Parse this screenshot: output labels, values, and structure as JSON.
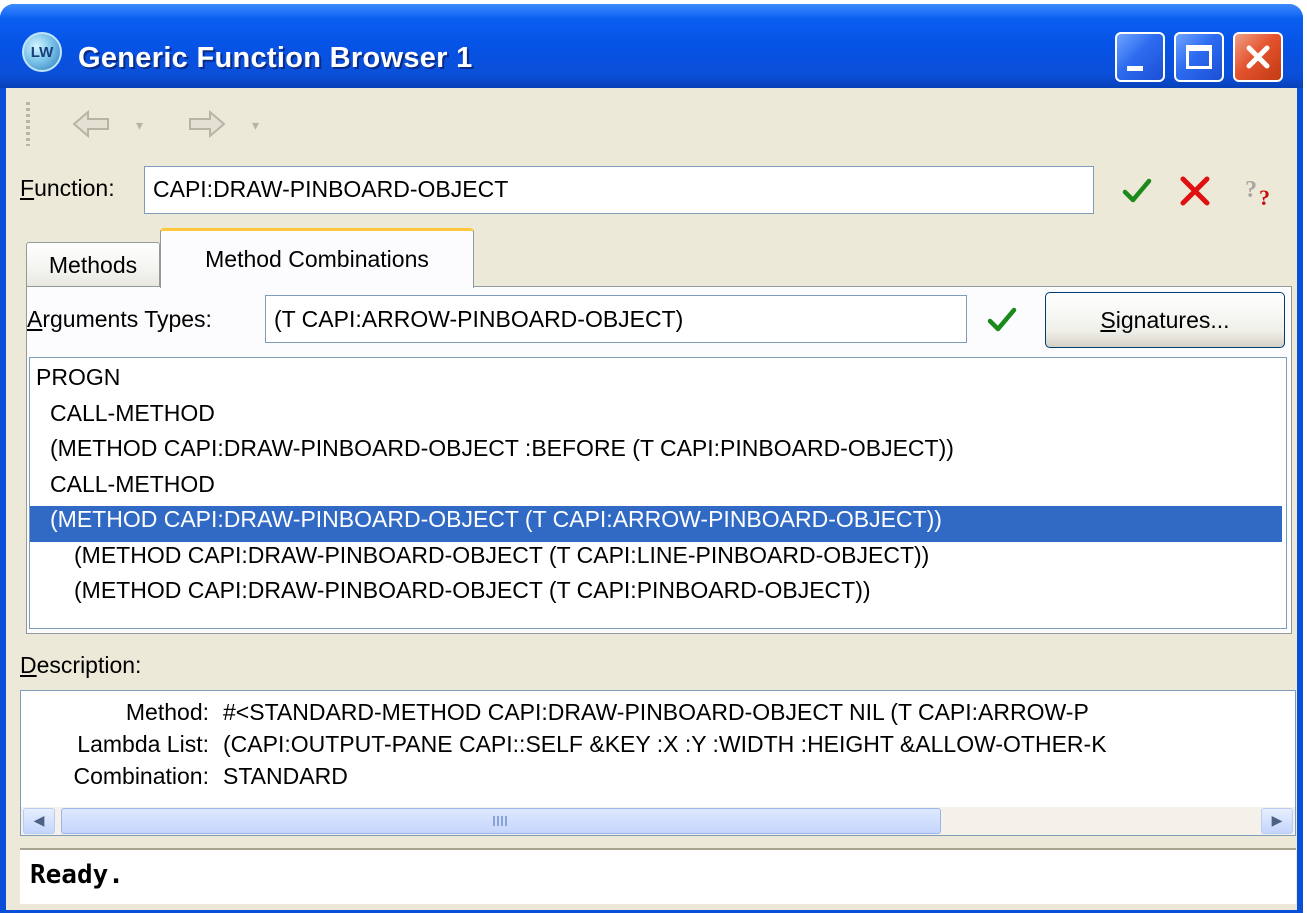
{
  "window": {
    "title": "Generic Function Browser 1",
    "app_icon_text": "LW"
  },
  "function": {
    "label_prefix": "F",
    "label_rest": "unction:",
    "value": "CAPI:DRAW-PINBOARD-OBJECT"
  },
  "tabs": [
    {
      "label": "Methods"
    },
    {
      "label": "Method Combinations"
    }
  ],
  "arguments": {
    "label_prefix": "A",
    "label_rest": "rguments Types:",
    "value": "(T CAPI:ARROW-PINBOARD-OBJECT)"
  },
  "signatures_button": {
    "label_prefix": "S",
    "label_rest": "ignatures..."
  },
  "tree": {
    "rows": [
      {
        "text": "PROGN",
        "indent": 0
      },
      {
        "text": "CALL-METHOD",
        "indent": 1
      },
      {
        "text": "(METHOD CAPI:DRAW-PINBOARD-OBJECT :BEFORE (T CAPI:PINBOARD-OBJECT))",
        "indent": 1
      },
      {
        "text": "CALL-METHOD",
        "indent": 1
      },
      {
        "text": "(METHOD CAPI:DRAW-PINBOARD-OBJECT (T CAPI:ARROW-PINBOARD-OBJECT))",
        "indent": 1,
        "selected": true
      },
      {
        "text": "(METHOD CAPI:DRAW-PINBOARD-OBJECT (T CAPI:LINE-PINBOARD-OBJECT))",
        "indent": 2
      },
      {
        "text": "(METHOD CAPI:DRAW-PINBOARD-OBJECT (T CAPI:PINBOARD-OBJECT))",
        "indent": 2
      }
    ]
  },
  "description": {
    "label_prefix": "D",
    "label_rest": "escription:",
    "rows": [
      {
        "key": "Method:",
        "value": "#<STANDARD-METHOD CAPI:DRAW-PINBOARD-OBJECT NIL (T CAPI:ARROW-P"
      },
      {
        "key": "Lambda List:",
        "value": "(CAPI:OUTPUT-PANE CAPI::SELF &KEY :X :Y :WIDTH :HEIGHT &ALLOW-OTHER-K"
      },
      {
        "key": "Combination:",
        "value": "STANDARD"
      }
    ]
  },
  "status": {
    "text": "Ready."
  },
  "icons": {
    "titlebar": [
      "lispworks-app-icon",
      "minimize-icon",
      "maximize-icon",
      "close-icon"
    ],
    "toolbar": [
      "back-arrow-icon",
      "back-dropdown-icon",
      "forward-arrow-icon",
      "forward-dropdown-icon"
    ],
    "function_row": [
      "apply-check-icon",
      "cancel-x-icon",
      "help-question-icon"
    ],
    "arguments_row": [
      "apply-check-icon"
    ]
  },
  "colors": {
    "titlebar_blue": "#0653e6",
    "selection_blue": "#316ac5",
    "active_tab_accent": "#ffc83c",
    "check_green": "#1b8a1b",
    "cancel_red": "#e01010",
    "close_red": "#e3542e",
    "face": "#ece9d8"
  }
}
